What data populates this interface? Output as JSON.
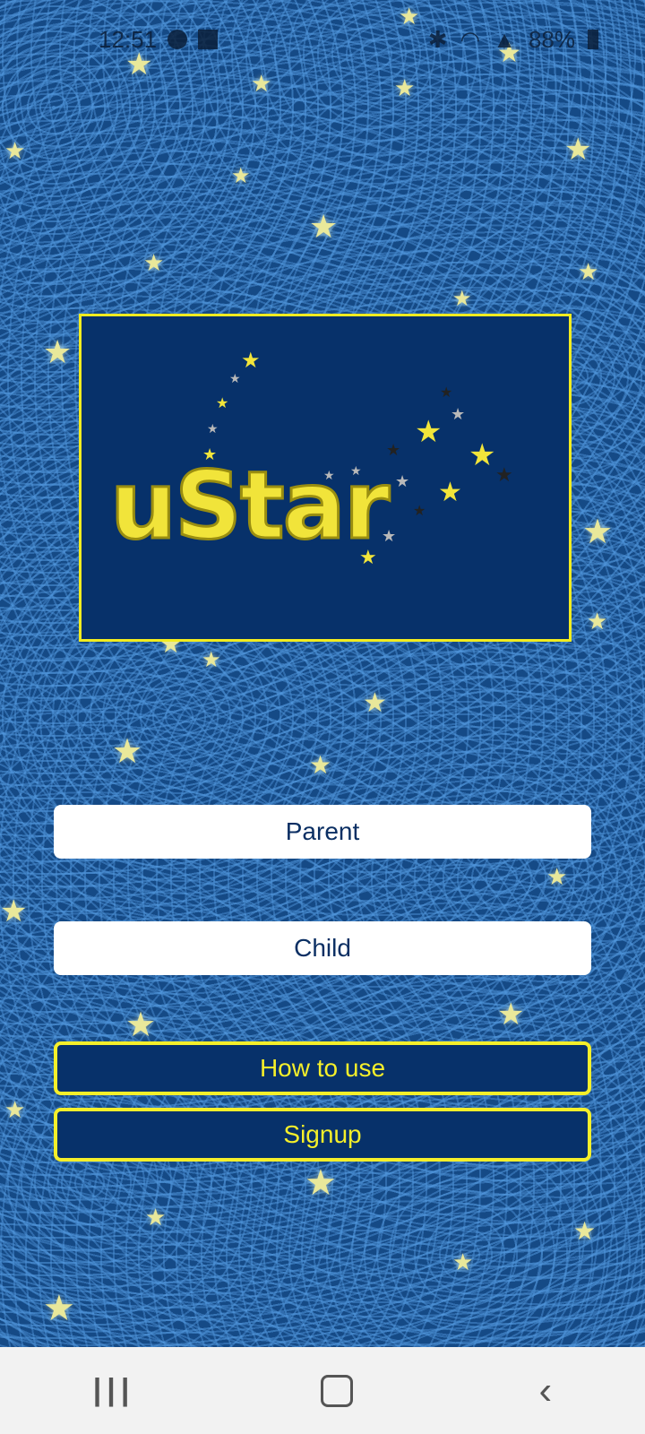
{
  "status_bar": {
    "time": "12:51",
    "battery": "88%"
  },
  "logo": {
    "text": "uStar"
  },
  "buttons": {
    "parent": "Parent",
    "child": "Child",
    "how_to_use": "How to use",
    "signup": "Signup"
  },
  "nav": {
    "recents_glyph": "|||",
    "home_glyph": "",
    "back_glyph": "‹"
  },
  "colors": {
    "accent_yellow": "#f5ef2a",
    "button_blue": "#07316a",
    "text_navy": "#0b2f63"
  }
}
